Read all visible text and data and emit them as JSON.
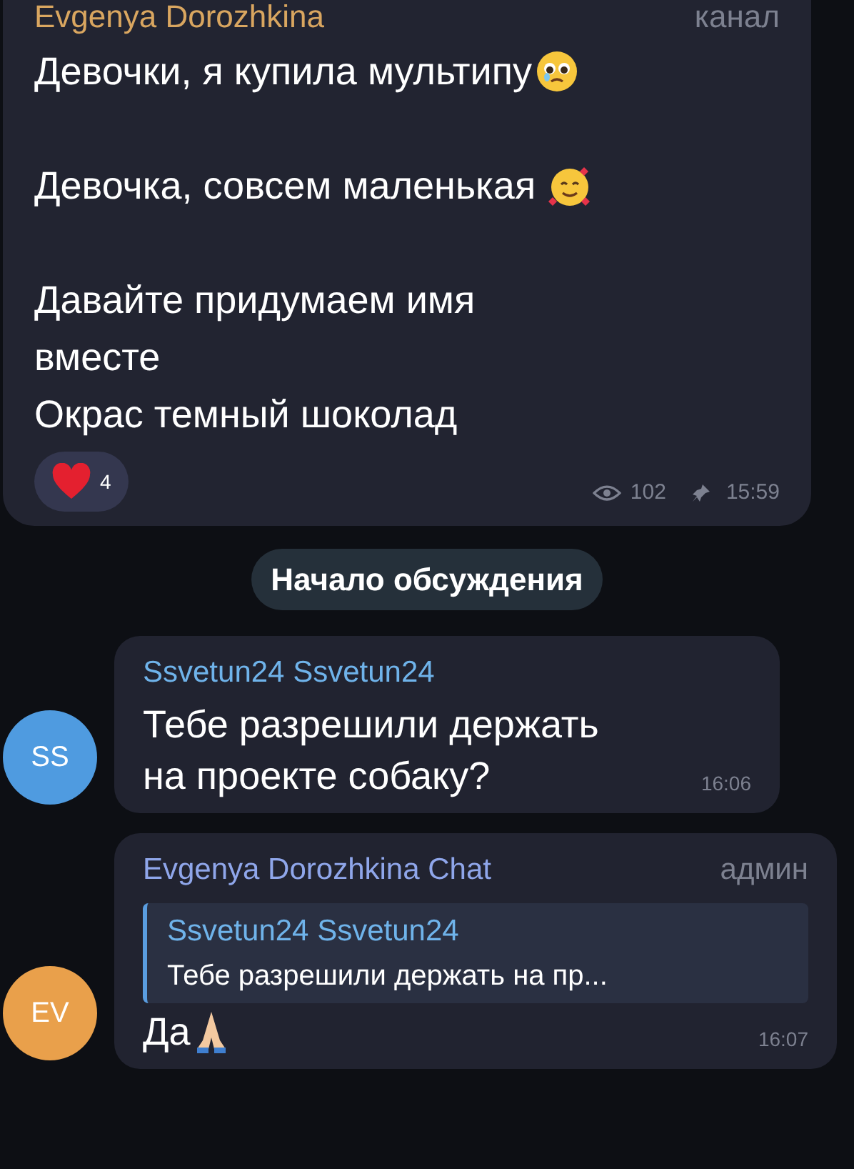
{
  "channel_post": {
    "author": "Evgenya Dorozhkina",
    "badge": "канал",
    "paragraphs": [
      {
        "lines": [
          "Девочки, я купила мультипу"
        ],
        "kind": "pleading"
      },
      {
        "lines": [
          "Девочка, совсем маленькая"
        ],
        "kind": "hearts"
      },
      {
        "lines": [
          "Давайте придумаем имя",
          "вместе",
          "Окрас темный шоколад"
        ],
        "kind": "plain"
      }
    ],
    "reaction": {
      "count": "4",
      "selected": true
    },
    "views": "102",
    "pinned": true,
    "time": "15:59"
  },
  "divider": "Начало обсуждения",
  "messages": [
    {
      "kind": "plain",
      "avatar": {
        "initials": "SS",
        "color": "#4f9be0"
      },
      "author": {
        "name": "Ssvetun24 Ssvetun24",
        "color": "#6fb3ea"
      },
      "lines": [
        "Тебе разрешили держать",
        "на проекте собаку?"
      ],
      "time": "16:06"
    },
    {
      "kind": "pray",
      "avatar": {
        "initials": "EV",
        "color": "#e9a04b"
      },
      "author": {
        "name": "Evgenya Dorozhkina Chat",
        "color": "#8fa6ea"
      },
      "badge": "админ",
      "reply": {
        "author": "Ssvetun24 Ssvetun24",
        "text": "Тебе разрешили держать на пр..."
      },
      "lines": [
        "Да"
      ],
      "time": "16:07"
    }
  ]
}
